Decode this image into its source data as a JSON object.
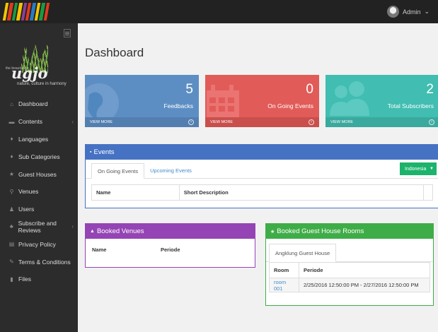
{
  "colors": {
    "topbar": "#222222",
    "sidebar": "#2c2c2c",
    "blue_stat": "#5d8ec3",
    "red_stat": "#e15b59",
    "teal_stat": "#41bdb1",
    "events_panel": "#4672c4",
    "venues_panel": "#9444b4",
    "guesthouse_panel": "#3fad47",
    "select_green": "#1cb36c"
  },
  "topbar": {
    "user_name": "Admin",
    "user_caret": "⌄",
    "user_icon": "avatar"
  },
  "brand": {
    "small_text": "the beauty of",
    "wordmark": "ugjo",
    "tagline": "nature, culture in harmony"
  },
  "sidebar": {
    "items": [
      {
        "label": "Dashboard",
        "icon": "home-icon",
        "glyph": "⌂",
        "arrow": ""
      },
      {
        "label": "Contents",
        "icon": "folder-icon",
        "glyph": "▬",
        "arrow": "‹"
      },
      {
        "label": "Languages",
        "icon": "tag-icon",
        "glyph": "♦",
        "arrow": ""
      },
      {
        "label": "Sub Categories",
        "icon": "tags-icon",
        "glyph": "♦",
        "arrow": ""
      },
      {
        "label": "Guest Houses",
        "icon": "star-icon",
        "glyph": "★",
        "arrow": ""
      },
      {
        "label": "Venues",
        "icon": "sitemap-icon",
        "glyph": "⚲",
        "arrow": ""
      },
      {
        "label": "Users",
        "icon": "user-icon",
        "glyph": "♟",
        "arrow": ""
      },
      {
        "label": "Subscribe and Reviews",
        "icon": "users-icon",
        "glyph": "♣",
        "arrow": "‹"
      },
      {
        "label": "Privacy Policy",
        "icon": "list-icon",
        "glyph": "▤",
        "arrow": ""
      },
      {
        "label": "Terms & Conditions",
        "icon": "pencil-icon",
        "glyph": "✎",
        "arrow": ""
      },
      {
        "label": "Files",
        "icon": "file-icon",
        "glyph": "▮",
        "arrow": ""
      }
    ]
  },
  "page_title": "Dashboard",
  "stats": [
    {
      "value": "5",
      "label": "Feedbacks",
      "more": "VIEW MORE",
      "icon": "globe-icon"
    },
    {
      "value": "0",
      "label": "On Going Events",
      "more": "VIEW MORE",
      "icon": "calendar-icon"
    },
    {
      "value": "2",
      "label": "Total Subscribers",
      "more": "VIEW MORE",
      "icon": "users-icon"
    }
  ],
  "events": {
    "title": "Events",
    "tabs": [
      "On Going Events",
      "Upcoming Events"
    ],
    "active_tab": "On Going Events",
    "language_select": "Indonesia",
    "columns": [
      "Name",
      "Short Description",
      ""
    ]
  },
  "venues": {
    "title": "Booked Venues",
    "columns": [
      "Name",
      "Periode"
    ]
  },
  "guesthouse": {
    "title": "Booked Guest House Rooms",
    "tab": "Angklung Guest House",
    "columns": [
      "Room",
      "Periode"
    ],
    "rows": [
      {
        "room": "room 001",
        "periode": "2/25/2016 12:50:00 PM - 2/27/2016 12:50:00 PM"
      }
    ]
  }
}
